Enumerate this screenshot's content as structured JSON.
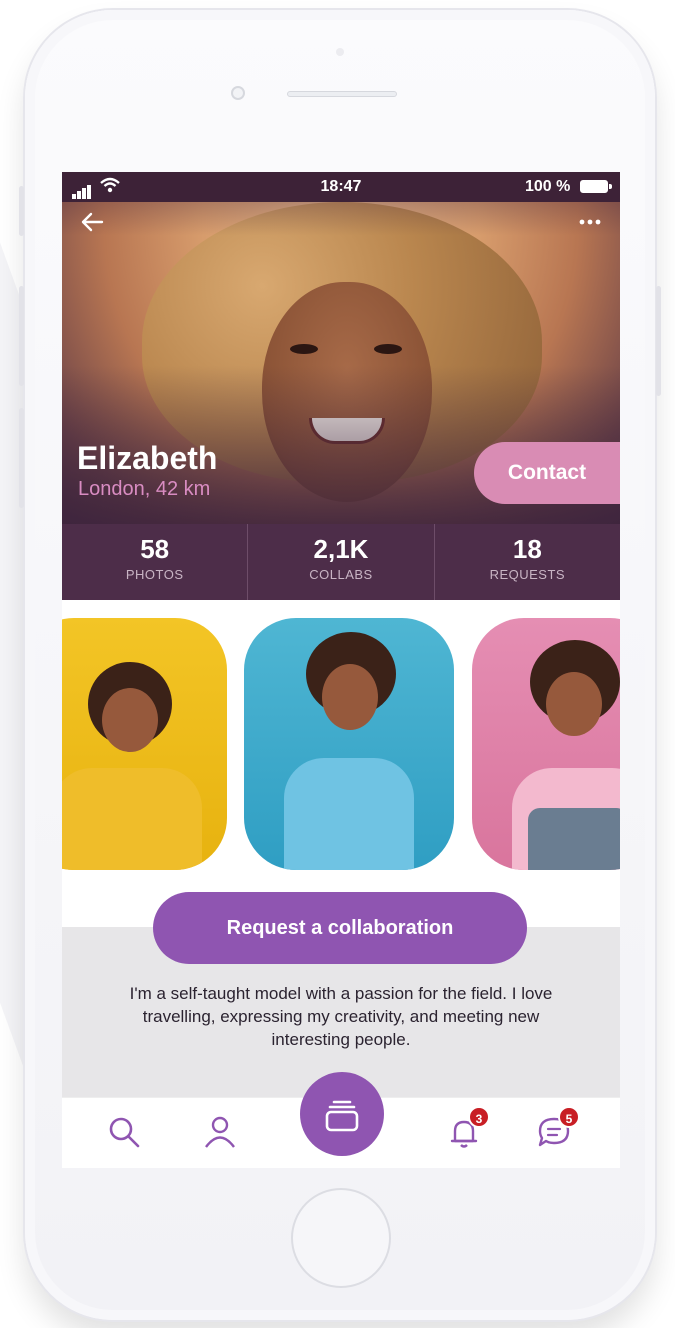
{
  "status_bar": {
    "time": "18:47",
    "battery": "100 %"
  },
  "profile": {
    "name": "Elizabeth",
    "location": "London, 42 km",
    "contact_label": "Contact"
  },
  "stats": [
    {
      "value": "58",
      "label": "PHOTOS"
    },
    {
      "value": "2,1K",
      "label": "COLLABS"
    },
    {
      "value": "18",
      "label": "REQUESTS"
    }
  ],
  "actions": {
    "request_label": "Request a collaboration"
  },
  "bio": "I'm a self-taught model with a passion for the field. I love travelling, expressing my creativity, and meeting new interesting people.",
  "tabs": [
    {
      "icon": "search-icon"
    },
    {
      "icon": "user-icon"
    },
    {
      "icon": "stack-icon"
    },
    {
      "icon": "bell-icon",
      "badge": "3"
    },
    {
      "icon": "chat-icon",
      "badge": "5"
    }
  ],
  "colors": {
    "accent": "#8f55b1",
    "contact": "#d98cb4",
    "stats_bg": "#4d2d49",
    "badge": "#c81e25",
    "location": "#d98cc2"
  }
}
